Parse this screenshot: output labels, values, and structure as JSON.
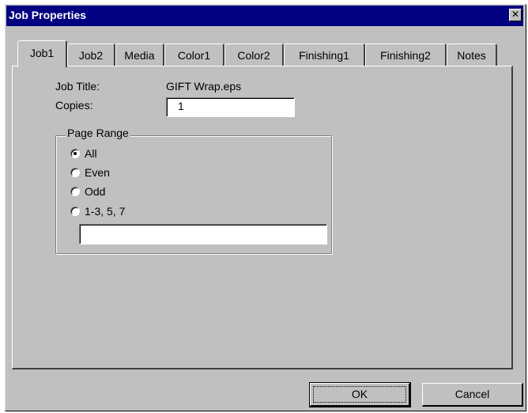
{
  "window": {
    "title": "Job Properties",
    "close_glyph": "✕"
  },
  "tabs": [
    {
      "label": "Job1",
      "active": true
    },
    {
      "label": "Job2",
      "active": false
    },
    {
      "label": "Media",
      "active": false
    },
    {
      "label": "Color1",
      "active": false
    },
    {
      "label": "Color2",
      "active": false
    },
    {
      "label": "Finishing1",
      "active": false
    },
    {
      "label": "Finishing2",
      "active": false
    },
    {
      "label": "Notes",
      "active": false
    }
  ],
  "job": {
    "title_label": "Job Title:",
    "title_value": "GIFT Wrap.eps",
    "copies_label": "Copies:",
    "copies_value": "1"
  },
  "page_range": {
    "legend": "Page Range",
    "options": [
      {
        "label": "All",
        "selected": true
      },
      {
        "label": "Even",
        "selected": false
      },
      {
        "label": "Odd",
        "selected": false
      },
      {
        "label": "1-3, 5, 7",
        "selected": false
      }
    ],
    "custom_value": ""
  },
  "buttons": {
    "ok": "OK",
    "cancel": "Cancel"
  }
}
